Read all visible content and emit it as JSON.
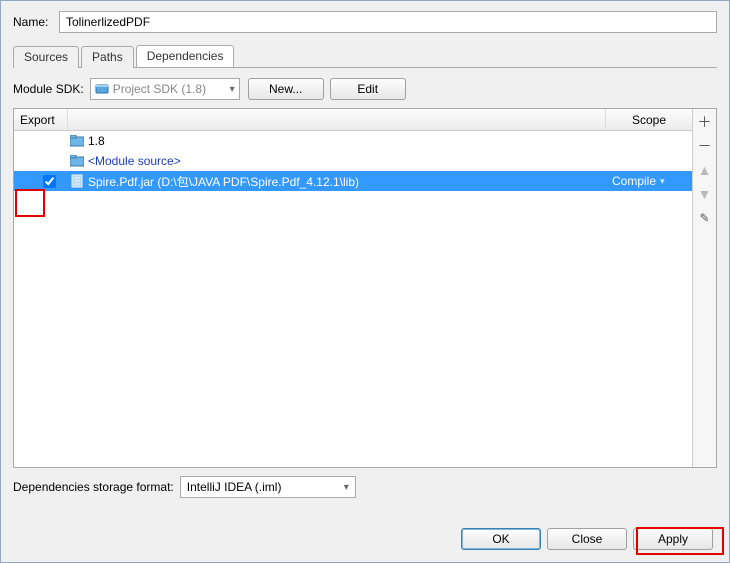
{
  "name_label": "Name:",
  "name_value": "TolinerlizedPDF",
  "tabs": {
    "sources": "Sources",
    "paths": "Paths",
    "dependencies": "Dependencies"
  },
  "sdk": {
    "label": "Module SDK:",
    "value": "Project SDK (1.8)",
    "new_btn": "New...",
    "edit_btn": "Edit"
  },
  "columns": {
    "export": "Export",
    "scope": "Scope"
  },
  "rows": {
    "r0": {
      "label": "1.8"
    },
    "r1": {
      "label": "<Module source>"
    },
    "r2": {
      "label": "Spire.Pdf.jar (D:\\包\\JAVA PDF\\Spire.Pdf_4.12.1\\lib)",
      "scope": "Compile"
    }
  },
  "storage": {
    "label": "Dependencies storage format:",
    "value": "IntelliJ IDEA (.iml)"
  },
  "footer": {
    "ok": "OK",
    "close": "Close",
    "apply": "Apply"
  }
}
